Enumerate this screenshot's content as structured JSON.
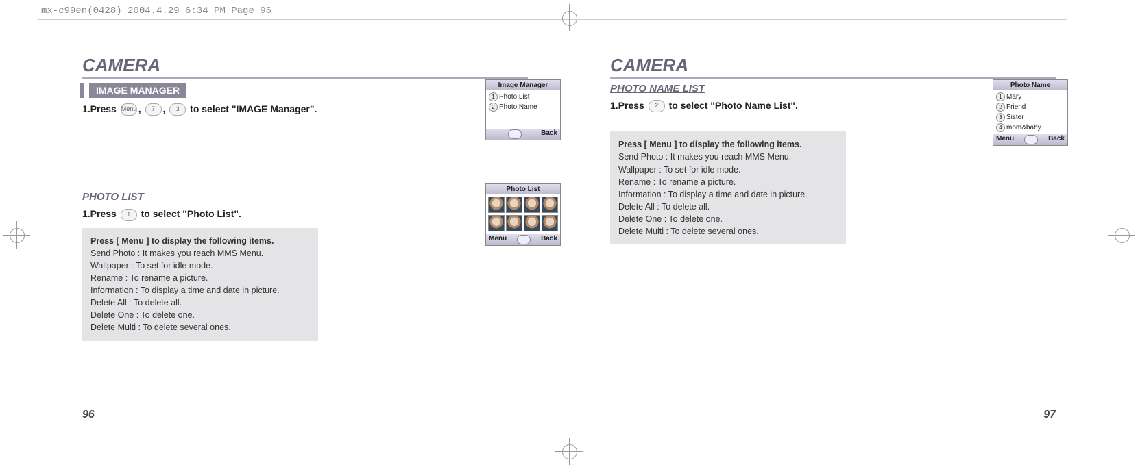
{
  "header_info": "mx-c99en(0428)  2004.4.29  6:34 PM  Page 96",
  "left": {
    "chapter": "CAMERA",
    "section_bar": "IMAGE MANAGER",
    "step1_pre": "1.Press",
    "step1_key1": "Menu",
    "step1_key2": "7",
    "step1_key3": "3",
    "step1_post": "to select \"IMAGE Manager\".",
    "sub_section": "PHOTO LIST",
    "step2_pre": "1.Press",
    "step2_key1": "1",
    "step2_post": "to select \"Photo List\".",
    "info_head_pre": "Press [",
    "info_head_key": "Menu",
    "info_head_post": "] to display the following items.",
    "info_lines": [
      "Send Photo : It makes you reach MMS Menu.",
      "Wallpaper : To set for idle mode.",
      "Rename : To rename a picture.",
      "Information : To display a time and date in picture.",
      "Delete All : To delete all.",
      "Delete One : To delete one.",
      "Delete Multi : To delete several ones."
    ],
    "page_num": "96",
    "mini1": {
      "title": "Image Manager",
      "rows": [
        {
          "n": "1",
          "label": "Photo List"
        },
        {
          "n": "2",
          "label": "Photo Name"
        }
      ],
      "foot_left": "",
      "foot_right": "Back"
    },
    "mini2": {
      "title": "Photo List",
      "foot_left": "Menu",
      "foot_right": "Back"
    }
  },
  "right": {
    "chapter": "CAMERA",
    "sub_section": "PHOTO NAME LIST",
    "step1_pre": "1.Press",
    "step1_key1": "2",
    "step1_post": "to select \"Photo Name List\".",
    "info_head_pre": "Press [",
    "info_head_key": "Menu",
    "info_head_post": "] to display the following items.",
    "info_lines": [
      "Send Photo : It makes you reach MMS Menu.",
      "Wallpaper : To set for idle mode.",
      "Rename : To rename a picture.",
      "Information : To display a time and date in picture.",
      "Delete All : To delete all.",
      "Delete One : To delete one.",
      "Delete Multi : To delete several ones."
    ],
    "page_num": "97",
    "mini3": {
      "title": "Photo Name",
      "rows": [
        {
          "n": "1",
          "label": "Mary"
        },
        {
          "n": "2",
          "label": "Friend"
        },
        {
          "n": "3",
          "label": "Sister"
        },
        {
          "n": "4",
          "label": "mom&baby"
        }
      ],
      "foot_left": "Menu",
      "foot_right": "Back"
    }
  }
}
